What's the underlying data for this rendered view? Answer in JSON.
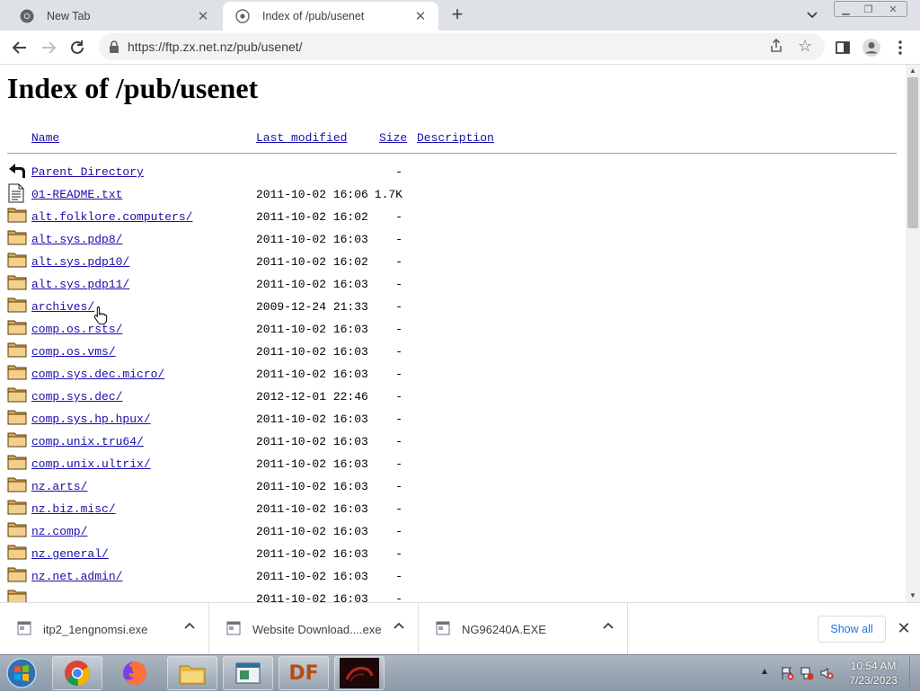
{
  "browser": {
    "tabs": [
      {
        "title": "New Tab",
        "active": false
      },
      {
        "title": "Index of /pub/usenet",
        "active": true
      }
    ],
    "url": "https://ftp.zx.net.nz/pub/usenet/"
  },
  "page": {
    "heading": "Index of /pub/usenet",
    "columns": {
      "name": "Name",
      "modified": "Last modified",
      "size": "Size",
      "description": "Description"
    },
    "entries": [
      {
        "name": "Parent Directory",
        "modified": "",
        "size": "-",
        "type": "parent"
      },
      {
        "name": "01-README.txt",
        "modified": "2011-10-02 16:06",
        "size": "1.7K",
        "type": "text"
      },
      {
        "name": "alt.folklore.computers/",
        "modified": "2011-10-02 16:02",
        "size": "-",
        "type": "folder"
      },
      {
        "name": "alt.sys.pdp8/",
        "modified": "2011-10-02 16:03",
        "size": "-",
        "type": "folder"
      },
      {
        "name": "alt.sys.pdp10/",
        "modified": "2011-10-02 16:02",
        "size": "-",
        "type": "folder"
      },
      {
        "name": "alt.sys.pdp11/",
        "modified": "2011-10-02 16:03",
        "size": "-",
        "type": "folder"
      },
      {
        "name": "archives/",
        "modified": "2009-12-24 21:33",
        "size": "-",
        "type": "folder"
      },
      {
        "name": "comp.os.rsts/",
        "modified": "2011-10-02 16:03",
        "size": "-",
        "type": "folder"
      },
      {
        "name": "comp.os.vms/",
        "modified": "2011-10-02 16:03",
        "size": "-",
        "type": "folder"
      },
      {
        "name": "comp.sys.dec.micro/",
        "modified": "2011-10-02 16:03",
        "size": "-",
        "type": "folder"
      },
      {
        "name": "comp.sys.dec/",
        "modified": "2012-12-01 22:46",
        "size": "-",
        "type": "folder"
      },
      {
        "name": "comp.sys.hp.hpux/",
        "modified": "2011-10-02 16:03",
        "size": "-",
        "type": "folder"
      },
      {
        "name": "comp.unix.tru64/",
        "modified": "2011-10-02 16:03",
        "size": "-",
        "type": "folder"
      },
      {
        "name": "comp.unix.ultrix/",
        "modified": "2011-10-02 16:03",
        "size": "-",
        "type": "folder"
      },
      {
        "name": "nz.arts/",
        "modified": "2011-10-02 16:03",
        "size": "-",
        "type": "folder"
      },
      {
        "name": "nz.biz.misc/",
        "modified": "2011-10-02 16:03",
        "size": "-",
        "type": "folder"
      },
      {
        "name": "nz.comp/",
        "modified": "2011-10-02 16:03",
        "size": "-",
        "type": "folder"
      },
      {
        "name": "nz.general/",
        "modified": "2011-10-02 16:03",
        "size": "-",
        "type": "folder"
      },
      {
        "name": "nz.net.admin/",
        "modified": "2011-10-02 16:03",
        "size": "-",
        "type": "folder"
      },
      {
        "name": "",
        "modified": "2011-10-02 16:03",
        "size": "-",
        "type": "folder"
      }
    ]
  },
  "downloads": {
    "items": [
      {
        "name": "itp2_1engnomsi.exe"
      },
      {
        "name": "Website Download....exe"
      },
      {
        "name": "NG96240A.EXE"
      }
    ],
    "show_all": "Show all"
  },
  "taskbar": {
    "apps": [
      "chrome-icon",
      "firefox-icon",
      "file-explorer-icon",
      "app-window-icon",
      "df-app-icon",
      "media-app-icon"
    ],
    "df_label": "DF",
    "time": "10:54 AM",
    "date": "7/23/2023"
  },
  "colors": {
    "link": "#1a0dab",
    "tabstrip": "#dee1e6",
    "accent": "#1a73e8"
  }
}
